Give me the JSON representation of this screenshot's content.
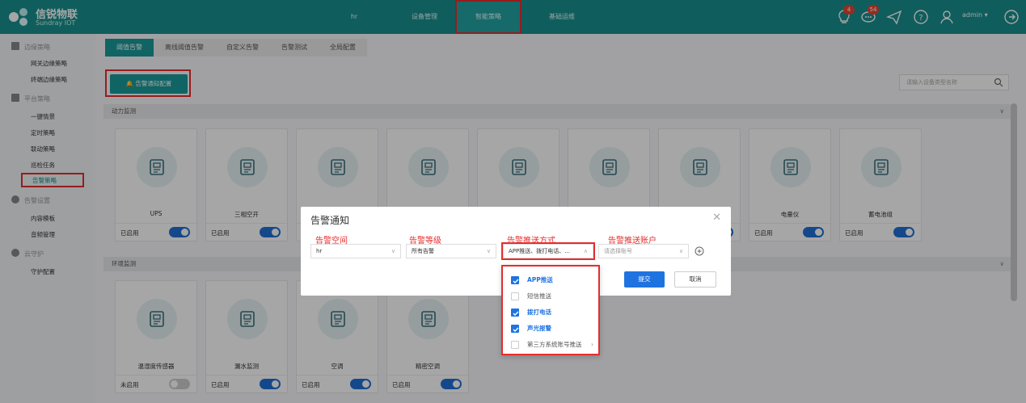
{
  "app": {
    "name": "信锐物联",
    "sub": "Sundray IOT"
  },
  "nav": [
    "hr",
    "设备管理",
    "智能策略",
    "基础运维"
  ],
  "header": {
    "badge_alert": "4",
    "badge_msg": "54",
    "user": "admin ▾"
  },
  "sidebar": {
    "group1": "边缘策略",
    "group1_items": [
      "网关边缘策略",
      "终端边缘策略"
    ],
    "group2": "平台策略",
    "group2_items": [
      "一键情景",
      "定时策略",
      "联动策略",
      "巡检任务",
      "告警策略"
    ],
    "group3": "告警设置",
    "group3_items": [
      "内容模板",
      "音频管理"
    ],
    "group4": "云守护",
    "group4_items": [
      "守护配置"
    ]
  },
  "tabs": [
    "阈值告警",
    "离线阈值告警",
    "自定义告警",
    "告警测试",
    "全局配置"
  ],
  "config_button": "告警通知配置",
  "search": {
    "placeholder": "请输入设备类型名称"
  },
  "section1": "动力监测",
  "section2": "环境监测",
  "cards_row1": [
    {
      "name": "UPS",
      "status": "已启用"
    },
    {
      "name": "三相空开",
      "status": "已启用"
    },
    {
      "name": "",
      "status": ""
    },
    {
      "name": "",
      "status": ""
    },
    {
      "name": "",
      "status": ""
    },
    {
      "name": "",
      "status": ""
    },
    {
      "name": "",
      "status": ""
    },
    {
      "name": "电量仪",
      "status": "已启用"
    },
    {
      "name": "蓄电池组",
      "status": "已启用"
    }
  ],
  "cards_row2": [
    {
      "name": "温湿度传感器",
      "status": "未启用"
    },
    {
      "name": "漏水监测",
      "status": "已启用"
    },
    {
      "name": "空调",
      "status": "已启用"
    },
    {
      "name": "精密空调",
      "status": "已启用"
    }
  ],
  "modal": {
    "title": "告警通知",
    "labels": [
      "告警空间",
      "告警等级",
      "告警推送方式",
      "告警推送账户"
    ],
    "space": "hr",
    "level": "所有告警",
    "method": "APP推送、拨打电话、...",
    "account_placeholder": "请选择账号",
    "submit": "提交",
    "cancel": "取消"
  },
  "dropdown": [
    {
      "label": "APP推送",
      "checked": true
    },
    {
      "label": "短信推送",
      "checked": false
    },
    {
      "label": "拨打电话",
      "checked": true
    },
    {
      "label": "声光报警",
      "checked": true
    },
    {
      "label": "第三方系统账号推送",
      "checked": false
    }
  ],
  "colors": {
    "header": "#1a8f8f",
    "accent": "#1f73e0",
    "highlight": "#e52d2d"
  }
}
